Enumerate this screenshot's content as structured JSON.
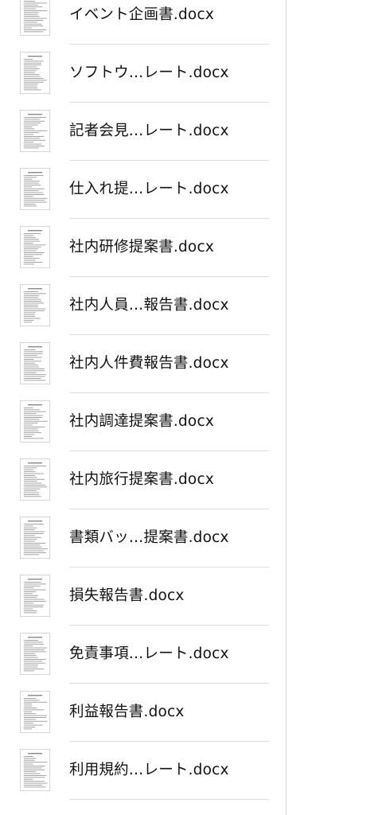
{
  "files": [
    {
      "name": "イベント企画書.docx",
      "icon": "document-thumbnail-icon"
    },
    {
      "name": "ソフトウ…レート.docx",
      "icon": "document-thumbnail-icon"
    },
    {
      "name": "記者会見…レート.docx",
      "icon": "document-thumbnail-icon"
    },
    {
      "name": "仕入れ提…レート.docx",
      "icon": "document-thumbnail-icon"
    },
    {
      "name": "社内研修提案書.docx",
      "icon": "document-thumbnail-icon"
    },
    {
      "name": "社内人員…報告書.docx",
      "icon": "document-thumbnail-icon"
    },
    {
      "name": "社内人件費報告書.docx",
      "icon": "document-thumbnail-icon"
    },
    {
      "name": "社内調達提案書.docx",
      "icon": "document-thumbnail-icon"
    },
    {
      "name": "社内旅行提案書.docx",
      "icon": "document-thumbnail-icon"
    },
    {
      "name": "書類バッ…提案書.docx",
      "icon": "document-thumbnail-icon"
    },
    {
      "name": "損失報告書.docx",
      "icon": "document-thumbnail-icon"
    },
    {
      "name": "免責事項…レート.docx",
      "icon": "document-thumbnail-icon"
    },
    {
      "name": "利益報告書.docx",
      "icon": "document-thumbnail-icon"
    },
    {
      "name": "利用規約…レート.docx",
      "icon": "document-thumbnail-icon"
    }
  ]
}
